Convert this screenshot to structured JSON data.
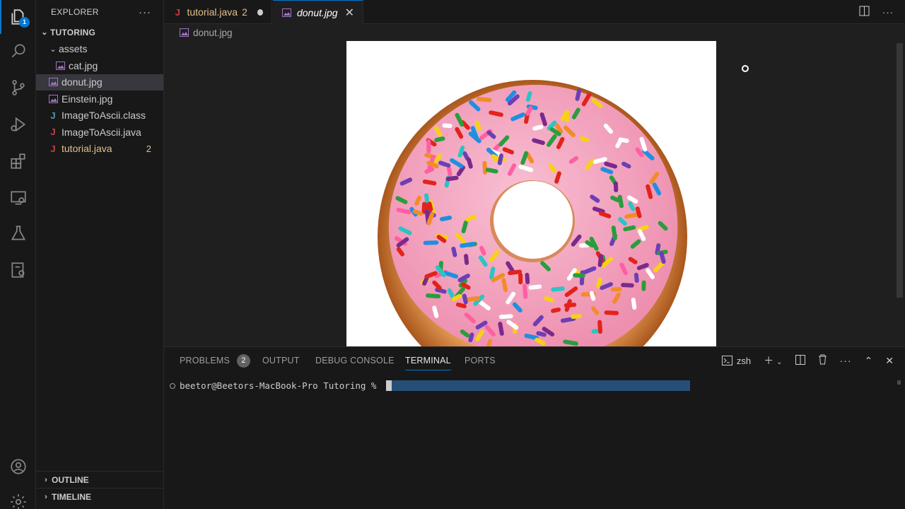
{
  "activity_bar": {
    "explorer_badge": "1",
    "icons": [
      "files-icon",
      "search-icon",
      "source-control-icon",
      "run-debug-icon",
      "extensions-icon",
      "remote-explorer-icon",
      "testing-icon",
      "docker-icon",
      "account-icon",
      "settings-gear-icon"
    ]
  },
  "sidebar": {
    "title": "EXPLORER",
    "more": "···",
    "root": "TUTORING",
    "folder": "assets",
    "files": [
      {
        "name": "cat.jpg",
        "type": "image"
      },
      {
        "name": "donut.jpg",
        "type": "image",
        "selected": true
      },
      {
        "name": "Einstein.jpg",
        "type": "image"
      },
      {
        "name": "ImageToAscii.class",
        "type": "class"
      },
      {
        "name": "ImageToAscii.java",
        "type": "java"
      },
      {
        "name": "tutorial.java",
        "type": "java",
        "badge": "2"
      }
    ],
    "outline": "OUTLINE",
    "timeline": "TIMELINE"
  },
  "tabs": [
    {
      "title": "tutorial.java",
      "count": "2",
      "icon": "J",
      "modified": true
    },
    {
      "title": "donut.jpg",
      "active": true,
      "close": "✕"
    }
  ],
  "breadcrumb": {
    "file": "donut.jpg"
  },
  "panel": {
    "tabs": [
      {
        "label": "PROBLEMS",
        "count": "2"
      },
      {
        "label": "OUTPUT"
      },
      {
        "label": "DEBUG CONSOLE"
      },
      {
        "label": "TERMINAL",
        "active": true
      },
      {
        "label": "PORTS"
      }
    ],
    "shell": "zsh",
    "prompt": "beetor@Beetors-MacBook-Pro Tutoring % "
  },
  "colors": {
    "accent": "#0078d4",
    "java": "#cc3e44",
    "modified": "#e2c08d",
    "frosting": "#f4a3bd",
    "dough": "#c8782f"
  }
}
